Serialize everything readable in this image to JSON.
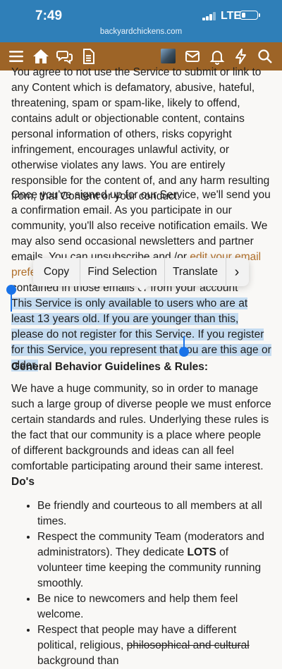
{
  "status_bar": {
    "time": "7:49",
    "network": "LTE",
    "url": "backyardchickens.com",
    "battery_level": 0.25
  },
  "nav": {
    "icons": [
      "menu-icon",
      "home-icon",
      "chat-icon",
      "document-icon",
      "avatar",
      "mail-icon",
      "bell-icon",
      "bolt-icon",
      "search-icon"
    ]
  },
  "content": {
    "para1": "You agree to not use the Service to submit or link to any Content which is defamatory, abusive, hateful, threatening, spam or spam-like, likely to offend, contains adult or objectionable content, contains personal information of others, risks copyright infringement, encourages unlawful activity, or otherwise violates any laws. You are entirely responsible for the content of, and any harm resulting from, that Content or your conduct.",
    "para2_before": "Once you've signed up for our Service, we'll send you a confirmation email. As you participate in our community, you'll also receive notification emails. We may also send occasional newsletters and partner emails. You can unsubscribe and /or ",
    "para2_link": "edit your email preferences in your account",
    "para2_mid": " at any time via links contained in those emails",
    "para2_after": " or from your account settings.",
    "para3_selected": "This Service is only available to users who are at least 13 years old. If you are younger than this, please do not register for this Service. If you register for this Service, you represent that you are this age or older.",
    "heading1": "General Behavior Guidelines & Rules:",
    "para4": "We have a huge community, so in order to manage such a large group of diverse people we must enforce certain standards and rules. Underlying these rules is the fact that our community  is a place where people of different backgrounds and ideas can all feel comfortable participating around their same interest.",
    "heading2": "Do's",
    "dos": {
      "item1": "Be friendly and courteous to all members at all times.",
      "item2_a": "Respect the community Team (moderators and administrators). They dedicate ",
      "item2_b": "LOTS",
      "item2_c": " of volunteer time keeping the community running smoothly.",
      "item3": "Be nice to newcomers and help them feel welcome.",
      "item4_a": "Respect that people may have a different political, religious, ",
      "item4_b": "philosophical and cultural",
      "item4_c": " background than"
    }
  },
  "context_menu": {
    "copy": "Copy",
    "find_selection": "Find Selection",
    "translate": "Translate",
    "more": "›"
  }
}
